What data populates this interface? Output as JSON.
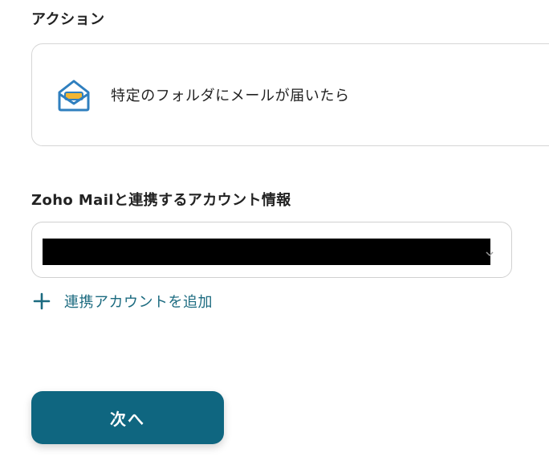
{
  "section": {
    "title": "アクション"
  },
  "action": {
    "label": "特定のフォルダにメールが届いたら",
    "icon": "zoho-mail-icon"
  },
  "account": {
    "title": "Zoho Mailと連携するアカウント情報",
    "selected_value": "",
    "add_label": "連携アカウントを追加"
  },
  "footer": {
    "next_label": "次へ"
  },
  "colors": {
    "accent": "#0f6680",
    "link": "#1c6b80",
    "icon_blue": "#2f7fbf",
    "icon_yellow": "#f2b632"
  }
}
